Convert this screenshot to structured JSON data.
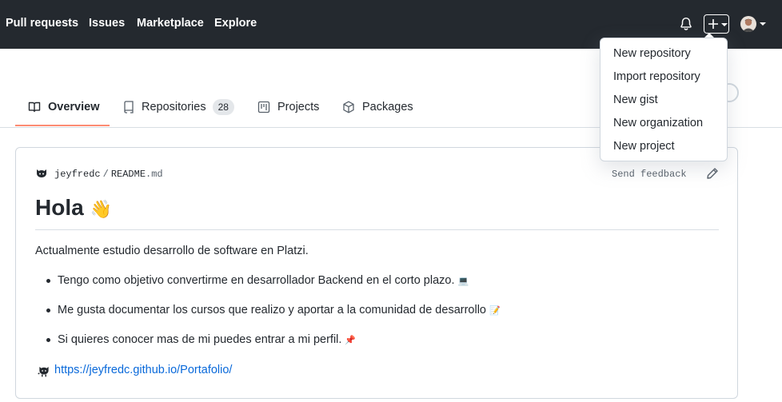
{
  "header": {
    "nav": [
      "Pull requests",
      "Issues",
      "Marketplace",
      "Explore"
    ],
    "icons": {
      "notifications": "bell-icon",
      "create": "plus-icon",
      "avatar": "user-avatar"
    }
  },
  "create_menu": {
    "items": [
      "New repository",
      "Import repository",
      "New gist",
      "New organization",
      "New project"
    ]
  },
  "tabs": [
    {
      "label": "Overview",
      "icon": "book-icon"
    },
    {
      "label": "Repositories",
      "icon": "repo-icon",
      "count": "28"
    },
    {
      "label": "Projects",
      "icon": "project-icon"
    },
    {
      "label": "Packages",
      "icon": "package-icon"
    }
  ],
  "readme": {
    "owner": "jeyfredc",
    "separator": "/",
    "file_name": "README",
    "file_ext": ".md",
    "send_feedback": "Send feedback",
    "heading": "Hola",
    "heading_emoji": "👋",
    "intro": "Actualmente estudio desarrollo de software en Platzi.",
    "bullets": [
      {
        "text": "Tengo como objetivo convertirme en desarrollador Backend en el corto plazo.",
        "emoji": "💻"
      },
      {
        "text": "Me gusta documentar los cursos que realizo y aportar a la comunidad de desarrollo",
        "emoji": "📝"
      },
      {
        "text": "Si quieres conocer mas de mi puedes entrar a mi perfil.",
        "emoji": "📌"
      }
    ],
    "link": "https://jeyfredc.github.io/Portafolio/"
  },
  "colors": {
    "header_bg": "#24292f",
    "tab_underline": "#fd8c73",
    "link": "#0969da"
  }
}
